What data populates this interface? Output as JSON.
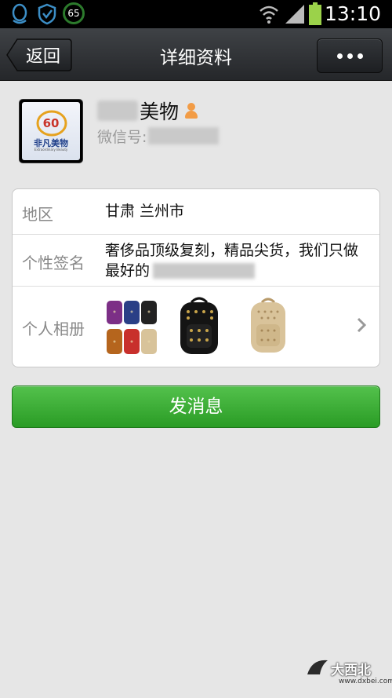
{
  "status_bar": {
    "time": "13:10",
    "badge_number": "65",
    "icons": [
      "qq-icon",
      "shield-icon",
      "speed-badge-icon",
      "wifi-icon",
      "signal-icon",
      "battery-icon"
    ]
  },
  "header": {
    "back_label": "返回",
    "title": "详细资料",
    "more_icon": "more-dots-icon"
  },
  "profile": {
    "name": "美物",
    "wechat_id_label": "微信号:",
    "avatar_badge": "60",
    "avatar_text": "非凡美物",
    "avatar_subtext": "Extraordinary Beauty",
    "gender_icon": "female-icon"
  },
  "details": {
    "region": {
      "label": "地区",
      "value": "甘肃  兰州市"
    },
    "signature": {
      "label": "个性签名",
      "value_line1": "奢侈品顶级复刻，精品尖货，我们只做",
      "value_line2": "最好的"
    },
    "album": {
      "label": "个人相册",
      "photos": [
        "backpacks-colors-photo",
        "black-backpack-photo",
        "beige-backpack-photo"
      ]
    }
  },
  "actions": {
    "send_message": "发消息"
  },
  "watermark": {
    "text": "大西北",
    "url": "www.dxbei.com"
  },
  "colors": {
    "accent_green": "#2fa12a",
    "titlebar": "#2e3034",
    "background": "#e6e6e6"
  }
}
